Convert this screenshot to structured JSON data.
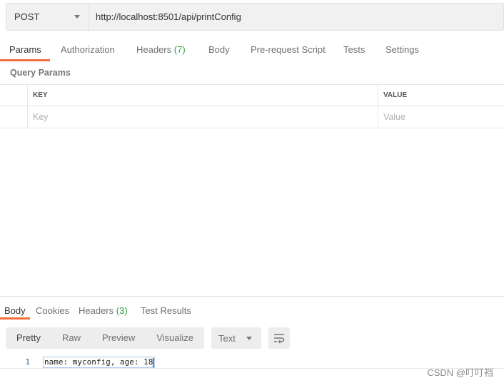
{
  "request": {
    "method": "POST",
    "url": "http://localhost:8501/api/printConfig"
  },
  "request_tabs": {
    "params": "Params",
    "authorization": "Authorization",
    "headers": "Headers",
    "headers_count": "(7)",
    "body": "Body",
    "prerequest": "Pre-request Script",
    "tests": "Tests",
    "settings": "Settings"
  },
  "query_params": {
    "title": "Query Params",
    "col_key": "KEY",
    "col_value": "VALUE",
    "key_placeholder": "Key",
    "value_placeholder": "Value"
  },
  "response_tabs": {
    "body": "Body",
    "cookies": "Cookies",
    "headers": "Headers",
    "headers_count": "(3)",
    "test_results": "Test Results"
  },
  "response_toolbar": {
    "pretty": "Pretty",
    "raw": "Raw",
    "preview": "Preview",
    "visualize": "Visualize",
    "format": "Text"
  },
  "response_body": {
    "line_number": "1",
    "line_text": "name: myconfig, age: 18"
  },
  "watermark": "CSDN @叮叮裆",
  "colors": {
    "accent": "#f26b3a",
    "count_green": "#2a9d3f"
  }
}
